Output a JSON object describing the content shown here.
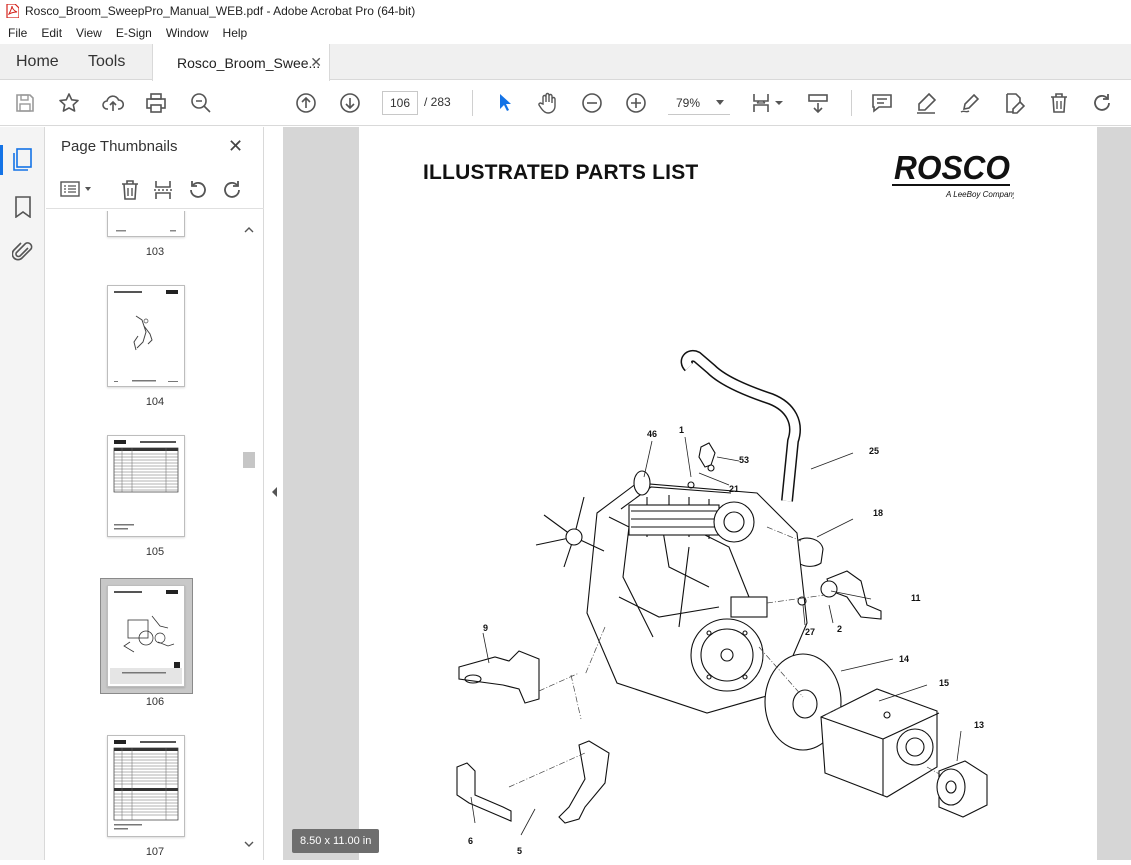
{
  "window": {
    "title": "Rosco_Broom_SweepPro_Manual_WEB.pdf - Adobe Acrobat Pro (64-bit)"
  },
  "menu": [
    "File",
    "Edit",
    "View",
    "E-Sign",
    "Window",
    "Help"
  ],
  "tabs": {
    "home": "Home",
    "tools": "Tools",
    "document": "Rosco_Broom_Swee..."
  },
  "toolbar": {
    "current_page": "106",
    "total_pages": "/ 283",
    "zoom": "79%"
  },
  "panel": {
    "title": "Page Thumbnails",
    "thumbnails": [
      {
        "label": "103"
      },
      {
        "label": "104"
      },
      {
        "label": "105"
      },
      {
        "label": "106",
        "selected": true
      },
      {
        "label": "107"
      }
    ]
  },
  "document": {
    "heading": "ILLUSTRATED PARTS LIST",
    "logo": "ROSCO",
    "logo_tagline": "A LeeBoy Company",
    "callouts": [
      "46",
      "1",
      "53",
      "21",
      "25",
      "18",
      "11",
      "27",
      "2",
      "9",
      "14",
      "15",
      "13",
      "6",
      "5"
    ],
    "page_size": "8.50 x 11.00 in"
  },
  "colors": {
    "accent": "#1473e6",
    "pdf_red": "#d4231c"
  }
}
